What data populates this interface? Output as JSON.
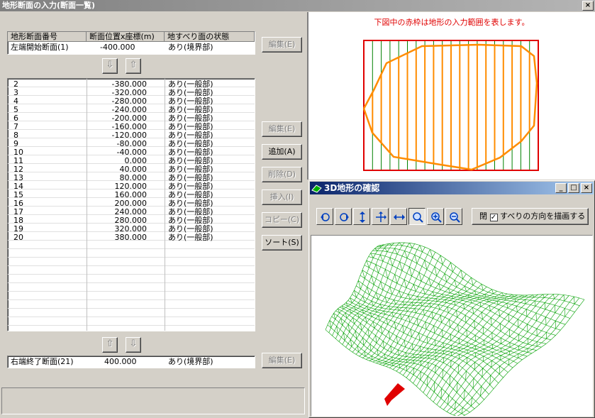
{
  "window": {
    "title": "地形断面の入力(断面一覧)",
    "close": "×"
  },
  "header": {
    "col1": "地形断面番号",
    "col2": "断面位置x座標(m)",
    "col3": "地すべり面の状態"
  },
  "start_row": {
    "label": "左端開始断面(1)",
    "x": "-400.000",
    "state": "あり(境界部)"
  },
  "end_row": {
    "label": "右端終了断面(21)",
    "x": "400.000",
    "state": "あり(境界部)"
  },
  "rows": [
    {
      "no": "2",
      "x": "-380.000",
      "state": "あり(一般部)"
    },
    {
      "no": "3",
      "x": "-320.000",
      "state": "あり(一般部)"
    },
    {
      "no": "4",
      "x": "-280.000",
      "state": "あり(一般部)"
    },
    {
      "no": "5",
      "x": "-240.000",
      "state": "あり(一般部)"
    },
    {
      "no": "6",
      "x": "-200.000",
      "state": "あり(一般部)"
    },
    {
      "no": "7",
      "x": "-160.000",
      "state": "あり(一般部)"
    },
    {
      "no": "8",
      "x": "-120.000",
      "state": "あり(一般部)"
    },
    {
      "no": "9",
      "x": "-80.000",
      "state": "あり(一般部)"
    },
    {
      "no": "10",
      "x": "-40.000",
      "state": "あり(一般部)"
    },
    {
      "no": "11",
      "x": "0.000",
      "state": "あり(一般部)"
    },
    {
      "no": "12",
      "x": "40.000",
      "state": "あり(一般部)"
    },
    {
      "no": "13",
      "x": "80.000",
      "state": "あり(一般部)"
    },
    {
      "no": "14",
      "x": "120.000",
      "state": "あり(一般部)"
    },
    {
      "no": "15",
      "x": "160.000",
      "state": "あり(一般部)"
    },
    {
      "no": "16",
      "x": "200.000",
      "state": "あり(一般部)"
    },
    {
      "no": "17",
      "x": "240.000",
      "state": "あり(一般部)"
    },
    {
      "no": "18",
      "x": "280.000",
      "state": "あり(一般部)"
    },
    {
      "no": "19",
      "x": "320.000",
      "state": "あり(一般部)"
    },
    {
      "no": "20",
      "x": "380.000",
      "state": "あり(一般部)"
    }
  ],
  "buttons": {
    "edit": "編集(E)",
    "add": "追加(A)",
    "delete": "削除(D)",
    "insert": "挿入(I)",
    "copy": "コピー(C)",
    "sort": "ソート(S)",
    "down_arrow": "⇩",
    "up_arrow": "⇧"
  },
  "plan": {
    "caption": "下図中の赤枠は地形の入力範囲を表します。",
    "frame_color": "#e00000",
    "boundary_color": "#ff8c00",
    "section_line_color": "#008000"
  },
  "window3d": {
    "title": "3D地形の確認",
    "minimize": "_",
    "maximize": "□",
    "close": "×",
    "checkbox_label": "すべりの方向を描画する",
    "checkbox_prefix": "閉",
    "checked": true,
    "tools": [
      "rotate-left-icon",
      "rotate-right-icon",
      "move-vertical-icon",
      "move-all-icon",
      "move-horizontal-icon",
      "zoom-region-icon",
      "zoom-in-icon",
      "zoom-out-icon"
    ],
    "mesh_color": "#00a000",
    "arrow_color": "#e00000"
  }
}
